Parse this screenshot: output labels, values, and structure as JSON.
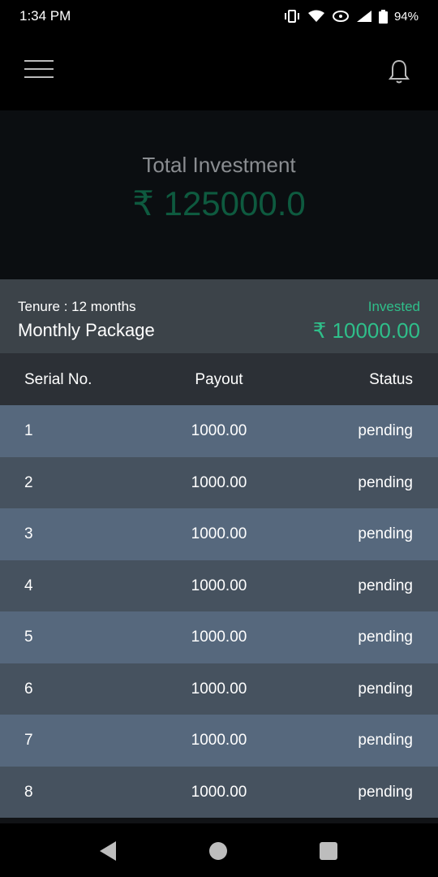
{
  "status_bar": {
    "time": "1:34 PM",
    "battery": "94%"
  },
  "hero": {
    "title": "Total Investment",
    "amount": "₹ 125000.0"
  },
  "package": {
    "tenure": "Tenure : 12 months",
    "name": "Monthly Package",
    "invested_label": "Invested",
    "invested_value": "₹ 10000.00"
  },
  "table": {
    "headers": [
      "Serial No.",
      "Payout",
      "Status"
    ],
    "rows": [
      {
        "serial": "1",
        "payout": "1000.00",
        "status": "pending"
      },
      {
        "serial": "2",
        "payout": "1000.00",
        "status": "pending"
      },
      {
        "serial": "3",
        "payout": "1000.00",
        "status": "pending"
      },
      {
        "serial": "4",
        "payout": "1000.00",
        "status": "pending"
      },
      {
        "serial": "5",
        "payout": "1000.00",
        "status": "pending"
      },
      {
        "serial": "6",
        "payout": "1000.00",
        "status": "pending"
      },
      {
        "serial": "7",
        "payout": "1000.00",
        "status": "pending"
      },
      {
        "serial": "8",
        "payout": "1000.00",
        "status": "pending"
      }
    ]
  },
  "colors": {
    "accent_green": "#2fbf8a",
    "hero_amount_green": "#0e5a3f",
    "row_light": "#56687d",
    "row_dark": "#46525f"
  },
  "icons": {
    "menu": "hamburger-menu-icon",
    "notifications": "bell-icon",
    "nav_back": "triangle-back-icon",
    "nav_home": "circle-home-icon",
    "nav_recent": "square-recents-icon"
  }
}
